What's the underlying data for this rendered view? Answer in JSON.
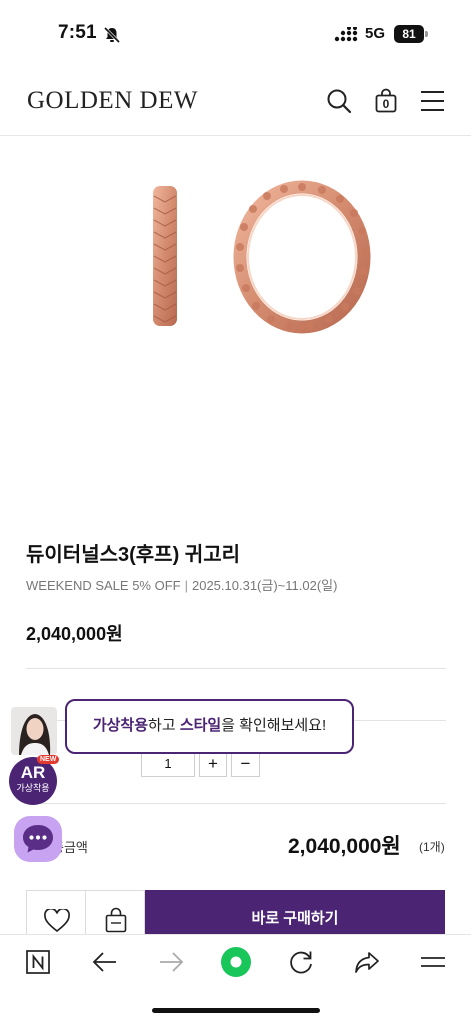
{
  "status_bar": {
    "time": "7:51",
    "network": "5G",
    "battery": "81"
  },
  "header": {
    "brand": "GOLDEN DEW",
    "cart_count": "0"
  },
  "product": {
    "name": "듀이터널스3(후프) 귀고리",
    "sale_name": "WEEKEND SALE 5% OFF",
    "sale_period": "2025.10.31(금)~11.02(일)",
    "price": "2,040,000원",
    "quantity": "1"
  },
  "qty_controls": {
    "plus": "+",
    "minus": "−"
  },
  "ar_popup": {
    "part1": "가상착용",
    "part2": "하고 ",
    "part3": "스타일",
    "part4": "을 확인해보세요!",
    "ar_label": "AR",
    "ar_sub": "가상착용",
    "new_badge": "NEW"
  },
  "total": {
    "label": "총금액",
    "price": "2,040,000원",
    "count": "(1개)"
  },
  "actions": {
    "buy_now": "바로 구매하기"
  },
  "colors": {
    "accent": "#4b2474",
    "rose_gold": "#d9957b",
    "chat": "#c7a3f2",
    "browser_green": "#19c65a"
  },
  "icons": {
    "header": [
      "search-icon",
      "bag-icon",
      "menu-icon"
    ],
    "actions": [
      "heart-icon",
      "cart-icon"
    ],
    "browser": [
      "naver-n-icon",
      "back-arrow-icon",
      "forward-arrow-icon",
      "green-dot-icon",
      "reload-icon",
      "share-icon",
      "menu-icon"
    ]
  }
}
